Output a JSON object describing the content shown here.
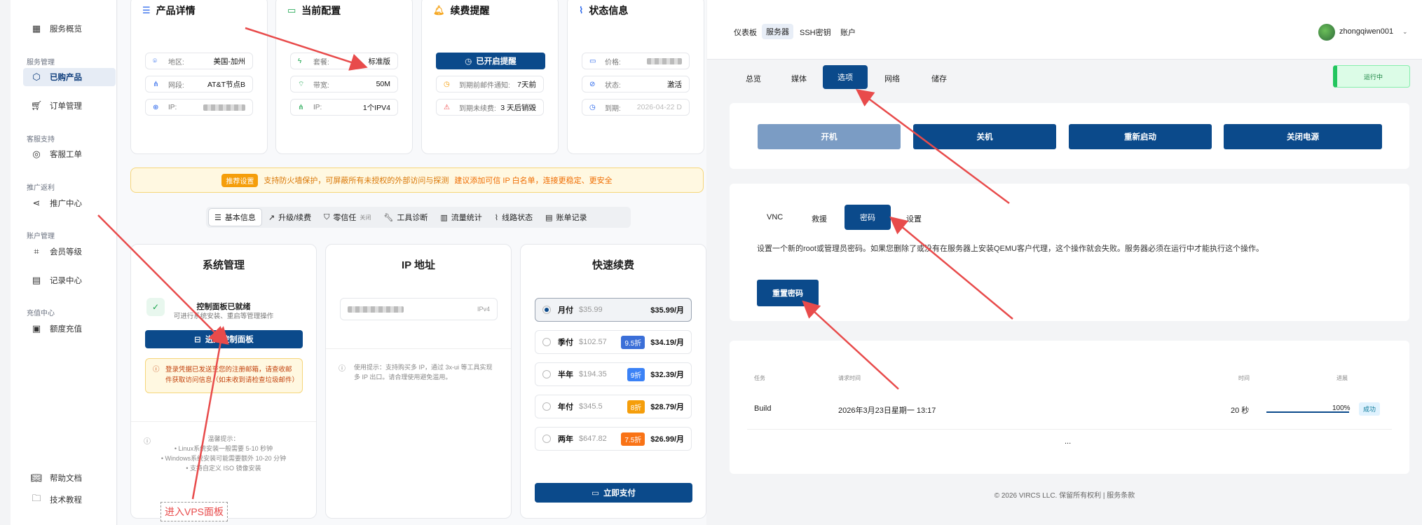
{
  "sidebar": {
    "overview": "服务概览",
    "sec_service": "服务管理",
    "purchased": "已购产品",
    "orders": "订单管理",
    "sec_support": "客服支持",
    "tickets": "客服工单",
    "sec_promo": "推广返利",
    "promo_center": "推广中心",
    "sec_account": "账户管理",
    "member_level": "会员等级",
    "records": "记录中心",
    "sec_recharge": "充值中心",
    "quota_recharge": "额度充值",
    "help_docs": "帮助文档",
    "tutorials": "技术教程"
  },
  "cards": {
    "product": {
      "title": "产品详情",
      "region_k": "地区:",
      "region_v": "美国-加州",
      "network_k": "网段:",
      "network_v": "AT&T节点B",
      "ip_k": "IP:"
    },
    "config": {
      "title": "当前配置",
      "plan_k": "套餐:",
      "plan_v": "标准版",
      "bandwidth_k": "带宽:",
      "bandwidth_v": "50M",
      "ip_k": "IP:",
      "ip_v": "1个IPV4"
    },
    "renewal": {
      "title": "续费提醒",
      "button": "已开启提醒",
      "notify_k": "到期前邮件通知:",
      "notify_v": "7天前",
      "unpaid_k": "到期未续费:",
      "unpaid_v": "3 天后销毁"
    },
    "status": {
      "title": "状态信息",
      "price_k": "价格:",
      "state_k": "状态:",
      "state_v": "激活",
      "expire_k": "到期:",
      "expire_v": "2026-04-22 D"
    }
  },
  "notice": {
    "badge": "推荐设置",
    "text": "支持防火墙保护，可屏蔽所有未授权的外部访问与探测",
    "link": "建议添加可信 IP 白名单，连接更稳定、更安全"
  },
  "tabs": {
    "basic": "基本信息",
    "upgrade": "升级/续费",
    "zerotrust": "零信任",
    "zerotrust_state": "关闭",
    "tools": "工具诊断",
    "traffic": "流量统计",
    "route": "线路状态",
    "billing": "账单记录"
  },
  "sysmgmt": {
    "title": "系统管理",
    "ready": "控制面板已就绪",
    "ready_sub": "可进行系统安装、重启等管理操作",
    "enter_btn": "进入控制面板",
    "warn": "登录凭据已发送至您的注册邮箱，请查收邮件获取访问信息（如未收到请检查垃圾邮件）",
    "tip_title": "温馨提示：",
    "tip1": "• Linux系统安装一般需要 5-10 秒钟",
    "tip2": "• Windows系统安装可能需要额外 10-20 分钟",
    "tip3": "• 支持自定义 ISO 镜像安装",
    "annotation": "进入VPS面板"
  },
  "ipaddr": {
    "title": "IP 地址",
    "tag": "IPv4",
    "hint": "使用提示：支持购买多 IP，通过 3x-ui 等工具实现多 IP 出口。请合理使用避免滥用。"
  },
  "quickpay": {
    "title": "快速续费",
    "rows": [
      {
        "name": "月付",
        "orig": "$35.99",
        "disc": "",
        "final": "$35.99/月"
      },
      {
        "name": "季付",
        "orig": "$102.57",
        "disc": "9.5折",
        "final": "$34.19/月"
      },
      {
        "name": "半年",
        "orig": "$194.35",
        "disc": "9折",
        "final": "$32.39/月"
      },
      {
        "name": "年付",
        "orig": "$345.5",
        "disc": "8折",
        "final": "$28.79/月"
      },
      {
        "name": "两年",
        "orig": "$647.82",
        "disc": "7.5折",
        "final": "$26.99/月"
      }
    ],
    "pay_btn": "立即支付"
  },
  "right": {
    "nav": {
      "dashboard": "仪表板",
      "servers": "服务器",
      "ssh": "SSH密钥",
      "account": "账户"
    },
    "user": "zhongqiwen001",
    "tabs": {
      "overview": "总览",
      "media": "媒体",
      "options": "选项",
      "network": "网络",
      "storage": "储存"
    },
    "running": "运行中",
    "power": {
      "on": "开机",
      "off": "关机",
      "restart": "重新启动",
      "poweroff": "关闭电源"
    },
    "subtabs": {
      "vnc": "VNC",
      "rescue": "救援",
      "password": "密码",
      "settings": "设置"
    },
    "pw_desc": "设置一个新的root或管理员密码。如果您删除了或没有在服务器上安装QEMU客户代理，这个操作就会失败。服务器必须在运行中才能执行这个操作。",
    "reset_btn": "重置密码",
    "table": {
      "h_task": "任务",
      "h_time": "请求时间",
      "h_duration": "时间",
      "h_progress": "进展",
      "task": "Build",
      "time": "2026年3月23日星期一 13:17",
      "duration": "20 秒",
      "progress": "100%",
      "status": "成功",
      "more": "..."
    },
    "footer": "© 2026 VIRCS LLC. 保留所有权利 | 服务条款"
  }
}
